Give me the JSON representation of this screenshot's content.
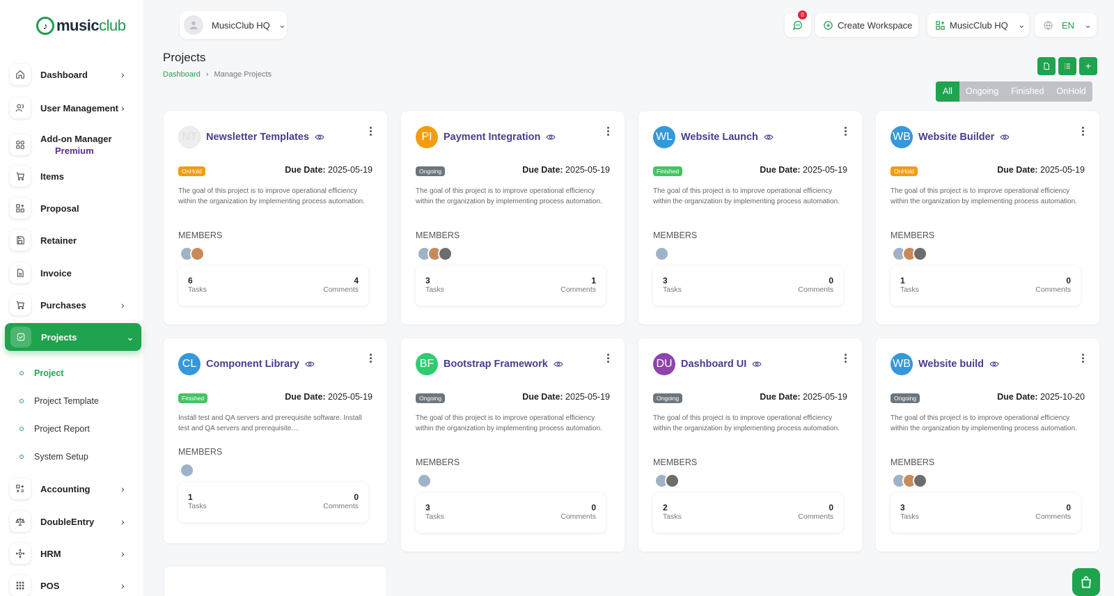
{
  "logo": {
    "text_bold": "music",
    "text_light": "club"
  },
  "sidebar": {
    "items": [
      {
        "label": "Dashboard",
        "icon": "home-icon"
      },
      {
        "label": "User Management",
        "icon": "users-icon"
      },
      {
        "label": "Add-on Manager",
        "sub": "Premium",
        "icon": "grid-icon"
      },
      {
        "label": "Items",
        "icon": "cart-icon"
      },
      {
        "label": "Proposal",
        "icon": "proposal-icon"
      },
      {
        "label": "Retainer",
        "icon": "save-icon"
      },
      {
        "label": "Invoice",
        "icon": "file-icon"
      },
      {
        "label": "Purchases",
        "icon": "cart-icon"
      },
      {
        "label": "Projects",
        "icon": "check-square-icon"
      },
      {
        "label": "Accounting",
        "icon": "calc-icon"
      },
      {
        "label": "DoubleEntry",
        "icon": "scale-icon"
      },
      {
        "label": "HRM",
        "icon": "hrm-icon"
      },
      {
        "label": "POS",
        "icon": "pos-icon"
      }
    ],
    "project_sub": [
      "Project",
      "Project Template",
      "Project Report",
      "System Setup"
    ]
  },
  "header": {
    "workspace": "MusicClub HQ",
    "notification_count": "0",
    "create_workspace": "Create Workspace",
    "workspace_switch": "MusicClub HQ",
    "language": "EN"
  },
  "page": {
    "title": "Projects",
    "breadcrumb": [
      "Dashboard",
      "Manage Projects"
    ]
  },
  "filters": [
    "All",
    "Ongoing",
    "Finished",
    "OnHold"
  ],
  "labels": {
    "due": "Due Date:",
    "members": "MEMBERS",
    "tasks": "Tasks",
    "comments": "Comments"
  },
  "colors": {
    "accent": "#1fa34e",
    "title": "#4b3b8f",
    "onhold": "#f39c12",
    "ongoing": "#6c757d",
    "finished": "#43c463"
  },
  "projects": [
    {
      "initials": "NT",
      "title": "Newsletter Templates",
      "status": "OnHold",
      "due": "2025-05-19",
      "desc": "The goal of this project is to improve operational efficiency within the organization by implementing process automation.",
      "tasks": "6",
      "comments": "4"
    },
    {
      "initials": "PI",
      "title": "Payment Integration",
      "status": "Ongoing",
      "due": "2025-05-19",
      "desc": "The goal of this project is to improve operational efficiency within the organization by implementing process automation.",
      "tasks": "3",
      "comments": "1"
    },
    {
      "initials": "WL",
      "title": "Website Launch",
      "status": "Finished",
      "due": "2025-05-19",
      "desc": "The goal of this project is to improve operational efficiency within the organization by implementing process automation.",
      "tasks": "3",
      "comments": "0"
    },
    {
      "initials": "WB",
      "title": "Website Builder",
      "status": "OnHold",
      "due": "2025-05-19",
      "desc": "The goal of this project is to improve operational efficiency within the organization by implementing process automation.",
      "tasks": "1",
      "comments": "0"
    },
    {
      "initials": "CL",
      "title": "Component Library",
      "status": "Finished",
      "due": "2025-05-19",
      "desc": "Install test and QA servers and prerequisite software. Install test and QA servers and prerequisite....",
      "tasks": "1",
      "comments": "0"
    },
    {
      "initials": "BF",
      "title": "Bootstrap Framework",
      "status": "Ongoing",
      "due": "2025-05-19",
      "desc": "The goal of this project is to improve operational efficiency within the organization by implementing process automation.",
      "tasks": "3",
      "comments": "0"
    },
    {
      "initials": "DU",
      "title": "Dashboard UI",
      "status": "Ongoing",
      "due": "2025-05-19",
      "desc": "The goal of this project is to improve operational efficiency within the organization by implementing process automation.",
      "tasks": "2",
      "comments": "0"
    },
    {
      "initials": "WB",
      "title": "Website build",
      "status": "Ongoing",
      "due": "2025-10-20",
      "desc": "The goal of this project is to improve operational efficiency within the organization by implementing process automation.",
      "tasks": "3",
      "comments": "0"
    }
  ]
}
